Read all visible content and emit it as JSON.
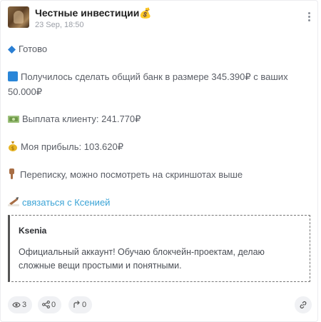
{
  "post": {
    "channel_title": "Честные инвестиции💰",
    "timestamp": "23 Sep, 18:50",
    "lines": [
      {
        "icon": "🔷",
        "text": "Готово"
      },
      {
        "icon": "🟦",
        "text": "Получилось сделать общий банк в размере 345.390₽ с ваших 50.000₽"
      },
      {
        "icon": "💵",
        "text": "Выплата клиенту: 241.770₽"
      },
      {
        "icon": "💰",
        "text": "Моя прибыль: 103.620₽"
      },
      {
        "icon": "👇🏽",
        "text": "Переписку, можно посмотреть на скриншотах выше"
      },
      {
        "icon": "✍🏽",
        "text": "связаться с Ксенией"
      }
    ]
  },
  "quote": {
    "name": "Ksenia",
    "text": "Официальный аккаунт! Обучаю блокчейн-проектам, делаю сложные вещи простыми и понятными."
  },
  "footer": {
    "views": "3",
    "shares": "0",
    "forwards": "0"
  },
  "colors": {
    "link": "#3aa3d6",
    "pill_bg": "#f0f1f4"
  }
}
